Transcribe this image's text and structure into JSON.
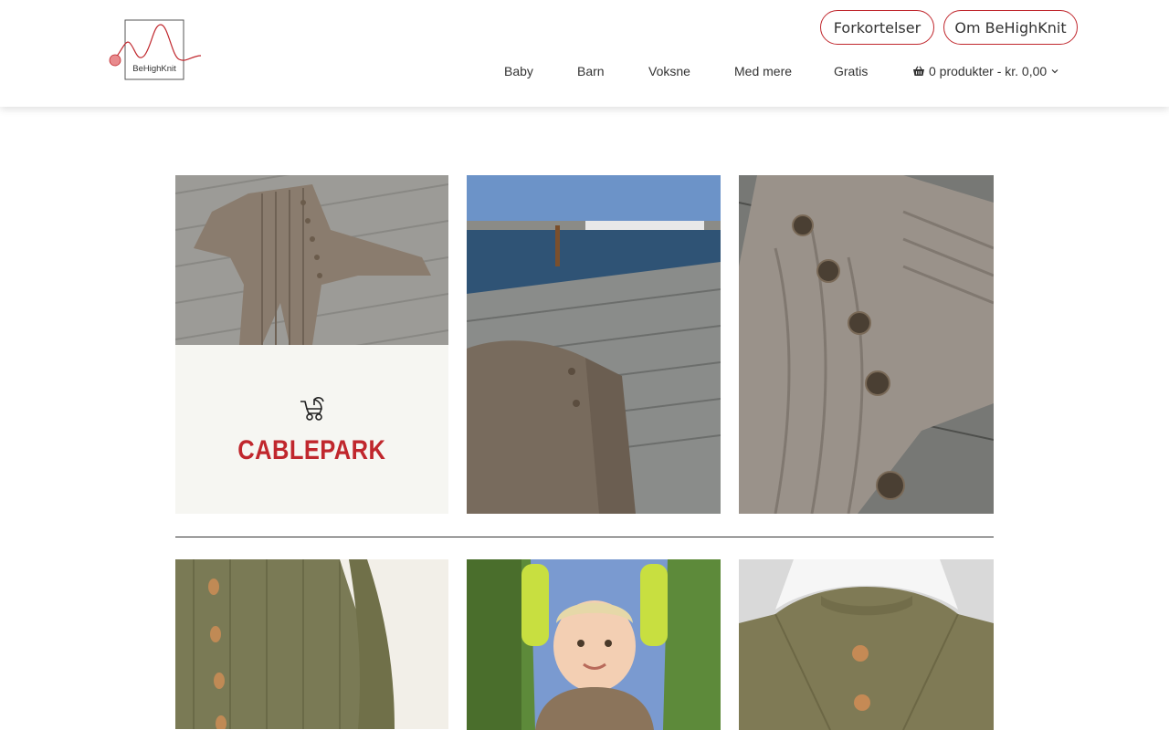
{
  "brand": {
    "logo_text": "BeHighKnit",
    "accent_color": "#c0272d"
  },
  "header": {
    "buttons": {
      "forkortelser": "Forkortelser",
      "om": "Om BeHighKnit"
    },
    "nav": [
      "Baby",
      "Barn",
      "Voksne",
      "Med mere",
      "Gratis"
    ],
    "cart": {
      "label": "0 produkter - kr. 0,00",
      "icon": "basket-icon"
    }
  },
  "product": {
    "title": "Cablepark",
    "category_icon": "stroller-icon"
  },
  "images": [
    {
      "name": "knitted-romper-on-deck"
    },
    {
      "name": "romper-on-pier-by-sea"
    },
    {
      "name": "romper-shoulder-buttons-detail"
    },
    {
      "name": "green-cardigan-button-band"
    },
    {
      "name": "toddler-in-sweater-on-slide"
    },
    {
      "name": "green-sweater-on-hanger"
    }
  ]
}
